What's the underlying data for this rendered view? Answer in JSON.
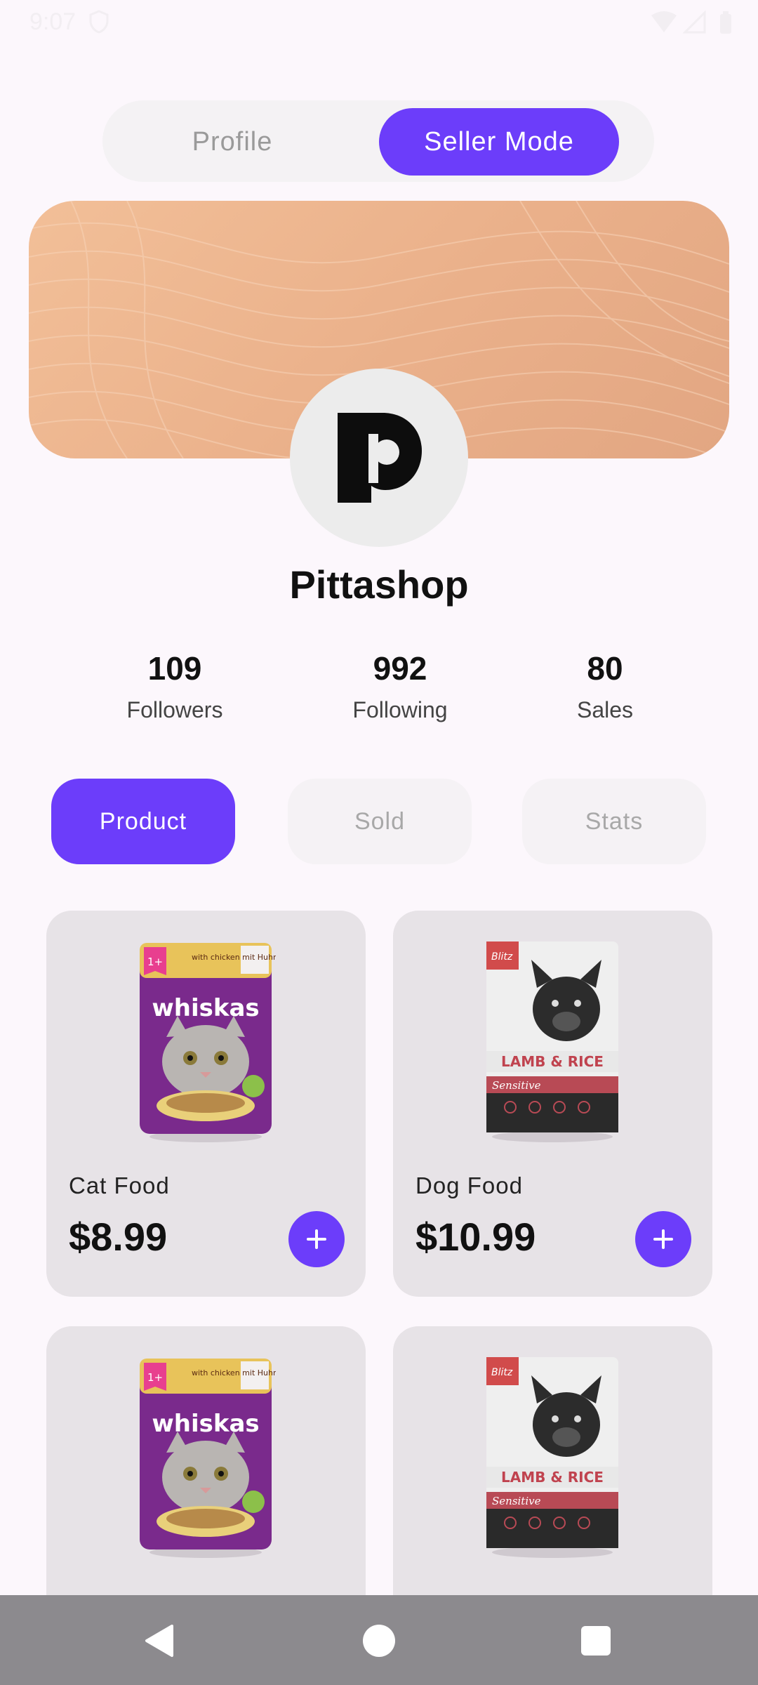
{
  "status_bar": {
    "time": "9:07"
  },
  "mode_toggle": {
    "profile_label": "Profile",
    "seller_label": "Seller Mode",
    "selected": "Seller Mode"
  },
  "shop": {
    "name": "Pittashop",
    "logo_letter": "p"
  },
  "stats": {
    "followers": {
      "value": "109",
      "label": "Followers"
    },
    "following": {
      "value": "992",
      "label": "Following"
    },
    "sales": {
      "value": "80",
      "label": "Sales"
    }
  },
  "section_tabs": {
    "product": "Product",
    "sold": "Sold",
    "stats": "Stats",
    "selected": "Product"
  },
  "products": [
    {
      "name": "Cat Food",
      "price": "$8.99",
      "image_icon": "whiskas-pouch",
      "brand": "whiskas",
      "pack_text": "with chicken mit Huhn",
      "age": "1+"
    },
    {
      "name": "Dog Food",
      "price": "$10.99",
      "image_icon": "dog-food-bag",
      "brand": "Blitz",
      "pack_text": "LAMB & RICE",
      "variant": "Sensitive"
    },
    {
      "name": "",
      "price": "",
      "image_icon": "whiskas-pouch",
      "brand": "whiskas",
      "pack_text": "with chicken mit Huhn",
      "age": "1+"
    },
    {
      "name": "",
      "price": "",
      "image_icon": "dog-food-bag",
      "brand": "Blitz",
      "pack_text": "LAMB & RICE",
      "variant": "Sensitive"
    }
  ],
  "colors": {
    "accent": "#6c3dfa",
    "background": "#fcf7fc",
    "card": "#e7e3e7",
    "banner": "#eab08a",
    "nav_bar": "#8c8a8e"
  }
}
